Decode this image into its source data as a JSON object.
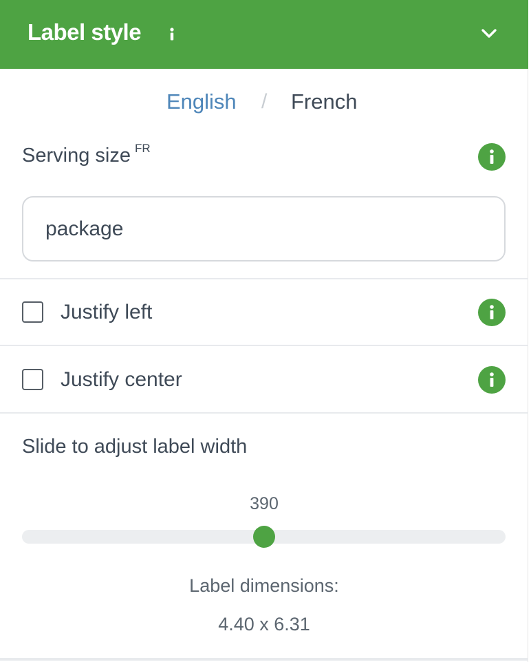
{
  "header": {
    "title": "Label style",
    "info_icon": "info-icon",
    "chevron_icon": "chevron-down-icon",
    "bg_color": "#4ea343"
  },
  "language": {
    "english": "English",
    "separator": "/",
    "french": "French",
    "active_color": "#4e86b9"
  },
  "serving_size": {
    "label": "Serving size",
    "superscript": "FR",
    "value": "package",
    "info_icon": "info-icon"
  },
  "options": [
    {
      "label": "Justify left",
      "checked": false,
      "info_icon": "info-icon"
    },
    {
      "label": "Justify center",
      "checked": false,
      "info_icon": "info-icon"
    }
  ],
  "slider": {
    "label": "Slide to adjust label width",
    "value": "390",
    "fraction": 0.5
  },
  "dimensions": {
    "label": "Label dimensions:",
    "value": "4.40 x 6.31"
  }
}
